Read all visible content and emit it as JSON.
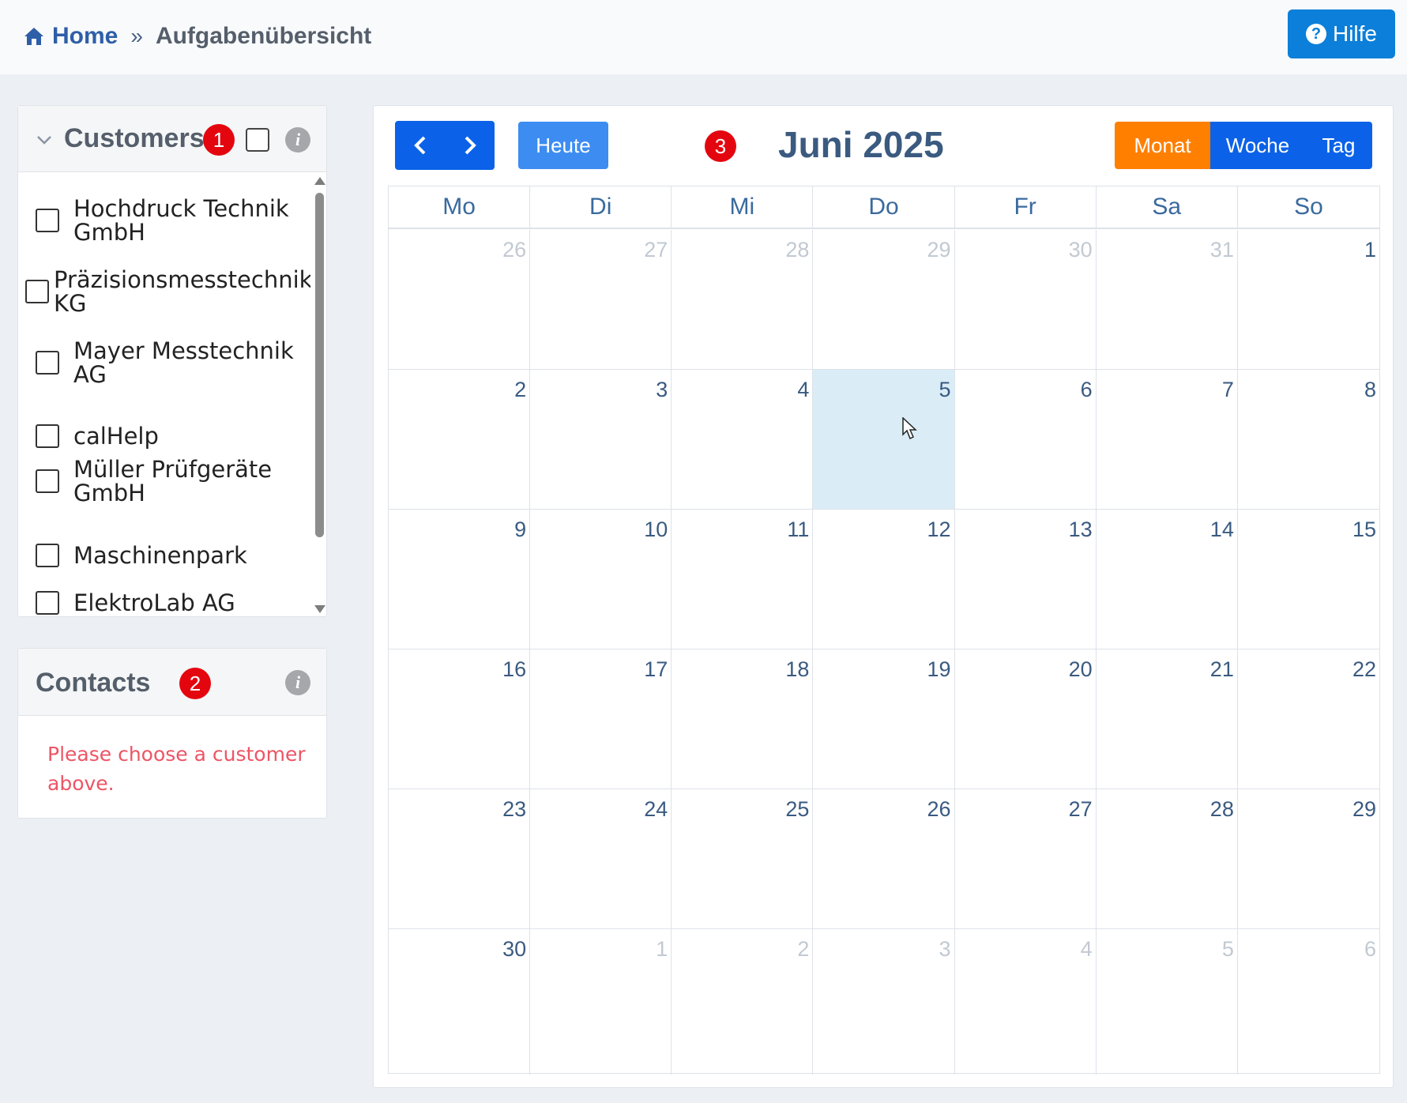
{
  "header": {
    "breadcrumb_home": "Home",
    "breadcrumb_separator": "»",
    "breadcrumb_current": "Aufgabenübersicht",
    "help_label": "Hilfe",
    "help_icon": "question-circle-icon",
    "accent_color": "#0b7fd9"
  },
  "customers": {
    "title": "Customers",
    "badge": "1",
    "items": [
      {
        "label": "Hochdruck Technik GmbH",
        "line1": "Hochdruck Technik",
        "line2": "GmbH"
      },
      {
        "label": "Präzisionsmesstechnik KG",
        "line1": "Präzisionsmesstechnik",
        "line2": "KG"
      },
      {
        "label": "Mayer Messtechnik AG",
        "line1": "Mayer Messtechnik",
        "line2": "AG"
      },
      {
        "label": "calHelp",
        "line1": "calHelp",
        "line2": ""
      },
      {
        "label": "Müller Prüfgeräte GmbH",
        "line1": "Müller Prüfgeräte",
        "line2": "GmbH"
      },
      {
        "label": "Maschinenpark",
        "line1": "Maschinenpark",
        "line2": ""
      },
      {
        "label": "ElektroLab AG",
        "line1": "ElektroLab AG",
        "line2": ""
      }
    ]
  },
  "contacts": {
    "title": "Contacts",
    "badge": "2",
    "message": "Please choose a customer above.",
    "message_color": "#ed5565"
  },
  "calendar": {
    "badge": "3",
    "title": "Juni 2025",
    "today_label": "Heute",
    "views": [
      {
        "label": "Monat",
        "active": true
      },
      {
        "label": "Woche",
        "active": false
      },
      {
        "label": "Tag",
        "active": false
      }
    ],
    "weekdays": [
      "Mo",
      "Di",
      "Mi",
      "Do",
      "Fr",
      "Sa",
      "So"
    ],
    "weeks": [
      [
        {
          "d": "26",
          "o": true
        },
        {
          "d": "27",
          "o": true
        },
        {
          "d": "28",
          "o": true
        },
        {
          "d": "29",
          "o": true
        },
        {
          "d": "30",
          "o": true
        },
        {
          "d": "31",
          "o": true
        },
        {
          "d": "1"
        }
      ],
      [
        {
          "d": "2"
        },
        {
          "d": "3"
        },
        {
          "d": "4"
        },
        {
          "d": "5",
          "today": true
        },
        {
          "d": "6"
        },
        {
          "d": "7"
        },
        {
          "d": "8"
        }
      ],
      [
        {
          "d": "9"
        },
        {
          "d": "10"
        },
        {
          "d": "11"
        },
        {
          "d": "12"
        },
        {
          "d": "13"
        },
        {
          "d": "14"
        },
        {
          "d": "15"
        }
      ],
      [
        {
          "d": "16"
        },
        {
          "d": "17"
        },
        {
          "d": "18"
        },
        {
          "d": "19"
        },
        {
          "d": "20"
        },
        {
          "d": "21"
        },
        {
          "d": "22"
        }
      ],
      [
        {
          "d": "23"
        },
        {
          "d": "24"
        },
        {
          "d": "25"
        },
        {
          "d": "26"
        },
        {
          "d": "27"
        },
        {
          "d": "28"
        },
        {
          "d": "29"
        }
      ],
      [
        {
          "d": "30"
        },
        {
          "d": "1",
          "o": true
        },
        {
          "d": "2",
          "o": true
        },
        {
          "d": "3",
          "o": true
        },
        {
          "d": "4",
          "o": true
        },
        {
          "d": "5",
          "o": true
        },
        {
          "d": "6",
          "o": true
        }
      ]
    ],
    "active_view_color": "#ff7f00",
    "primary_color": "#0b62e8",
    "today_highlight_color": "#daedf7"
  }
}
